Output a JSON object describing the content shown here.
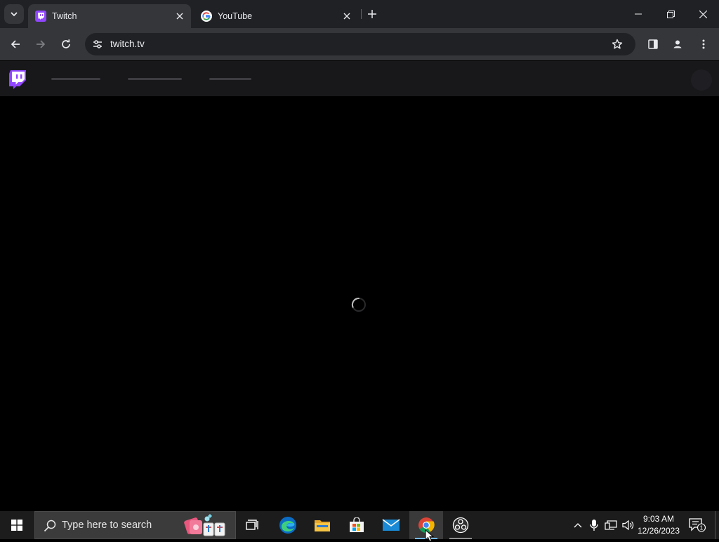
{
  "browser": {
    "tabs": [
      {
        "title": "Twitch",
        "favicon": "twitch-favicon",
        "active": true
      },
      {
        "title": "YouTube",
        "favicon": "google-favicon",
        "active": false
      }
    ],
    "omnibox": {
      "url": "twitch.tv"
    },
    "icons": {
      "back": "arrow-left-icon",
      "forward": "arrow-right-icon",
      "reload": "reload-icon",
      "site_info": "tune-icon",
      "bookmark": "star-icon",
      "side_panel": "side-panel-icon",
      "profile": "profile-icon",
      "menu": "kebab-menu-icon"
    },
    "window_controls": [
      "minimize",
      "restore",
      "close"
    ]
  },
  "twitch": {
    "brand_color": "#9146ff",
    "nav_state": "loading-skeleton",
    "content_state": "loading-spinner"
  },
  "taskbar": {
    "search_placeholder": "Type here to search",
    "apps": [
      "task-view",
      "edge",
      "file-explorer",
      "microsoft-store",
      "mail",
      "chrome",
      "obs-studio"
    ],
    "active_app": "chrome",
    "clock": {
      "time": "9:03 AM",
      "date": "12/26/2023"
    },
    "notification_count": "1"
  },
  "colors": {
    "tabstrip": "#202124",
    "toolbar": "#35363a",
    "twitch_header": "#18181b",
    "taskbar": "#1c1c1c",
    "accent": "#76b9ed"
  }
}
